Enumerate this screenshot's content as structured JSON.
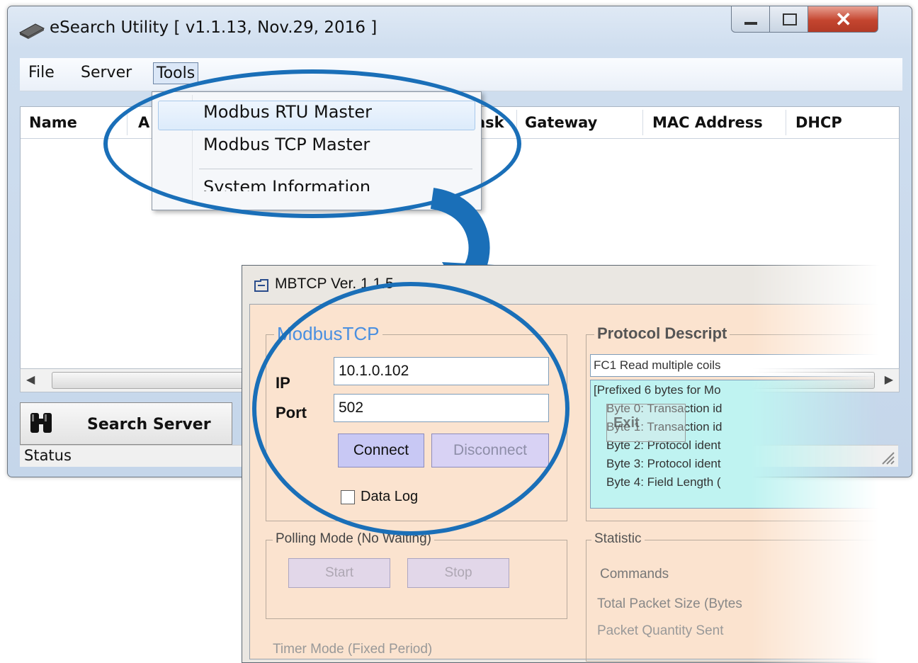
{
  "esearch": {
    "title": "eSearch Utility [ v1.1.13, Nov.29, 2016 ]",
    "menu": {
      "file": "File",
      "server": "Server",
      "tools": "Tools"
    },
    "columns": {
      "name": "Name",
      "a": "A",
      "ask": "ask",
      "gateway": "Gateway",
      "mac": "MAC Address",
      "dhcp": "DHCP"
    },
    "search_button": "Search Server",
    "status": "Status",
    "tools_menu": {
      "rtu": "Modbus RTU Master",
      "tcp": "Modbus TCP Master",
      "sysinfo": "System Information"
    }
  },
  "mbtcp": {
    "title": "MBTCP  Ver. 1.1.5",
    "group_title": "ModbusTCP",
    "ip_label": "IP",
    "ip_value": "10.1.0.102",
    "port_label": "Port",
    "port_value": "502",
    "connect": "Connect",
    "disconnect": "Disconnect",
    "data_log": "Data Log",
    "protocol_title": "Protocol Descript",
    "fc_select": "FC1  Read multiple coils",
    "protocol_lines": [
      "[Prefixed 6 bytes for Mo",
      "   Byte 0: Transaction id",
      "   Byte 1: Transaction id",
      "   Byte 2: Protocol ident",
      "   Byte 3: Protocol ident",
      "   Byte 4: Field Length ("
    ],
    "exit_partial": "Exit",
    "polling_title": "Polling Mode (No Waiting)",
    "start": "Start",
    "stop": "Stop",
    "statistic_title": "Statistic",
    "commands_title": "Commands",
    "total_packet": "Total Packet Size (Bytes",
    "packet_qty": "Packet Quantity Sent",
    "timer_mode": "Timer Mode (Fixed Period)"
  },
  "colors": {
    "callout": "#1a6fb8",
    "body": "#fbe3cf",
    "accent_text": "#4a8fe0"
  }
}
